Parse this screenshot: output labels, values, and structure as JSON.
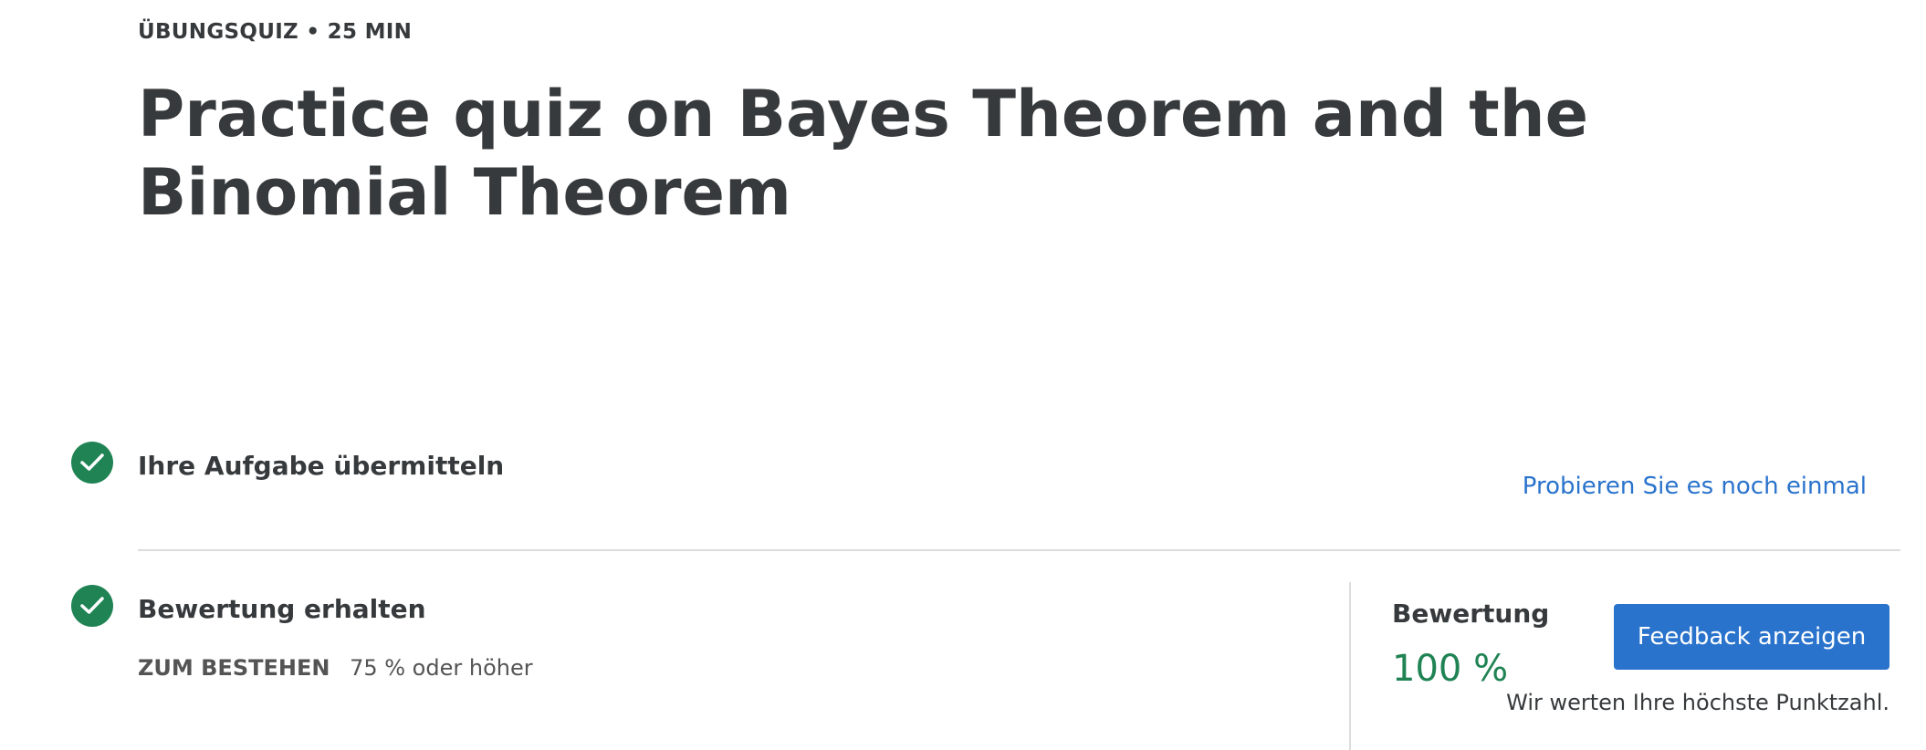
{
  "header": {
    "eyebrow": "ÜBUNGSQUIZ • 25 MIN",
    "title": "Practice quiz on Bayes Theorem and the Binomial Theorem"
  },
  "submit_step": {
    "icon": "check-circle-icon",
    "title": "Ihre Aufgabe übermitteln",
    "retry_link": "Probieren Sie es noch einmal"
  },
  "grade_step": {
    "icon": "check-circle-icon",
    "title": "Bewertung erhalten",
    "pass_label": "ZUM BESTEHEN",
    "pass_value": "75 % oder höher"
  },
  "grade_panel": {
    "label": "Bewertung",
    "value": "100 %",
    "feedback_button": "Feedback anzeigen",
    "note": "Wir werten Ihre höchste Punktzahl."
  },
  "colors": {
    "success_green": "#1f8354",
    "accent_blue": "#2a73cc",
    "text_dark": "#373a3c",
    "divider": "#dcdcdc"
  }
}
